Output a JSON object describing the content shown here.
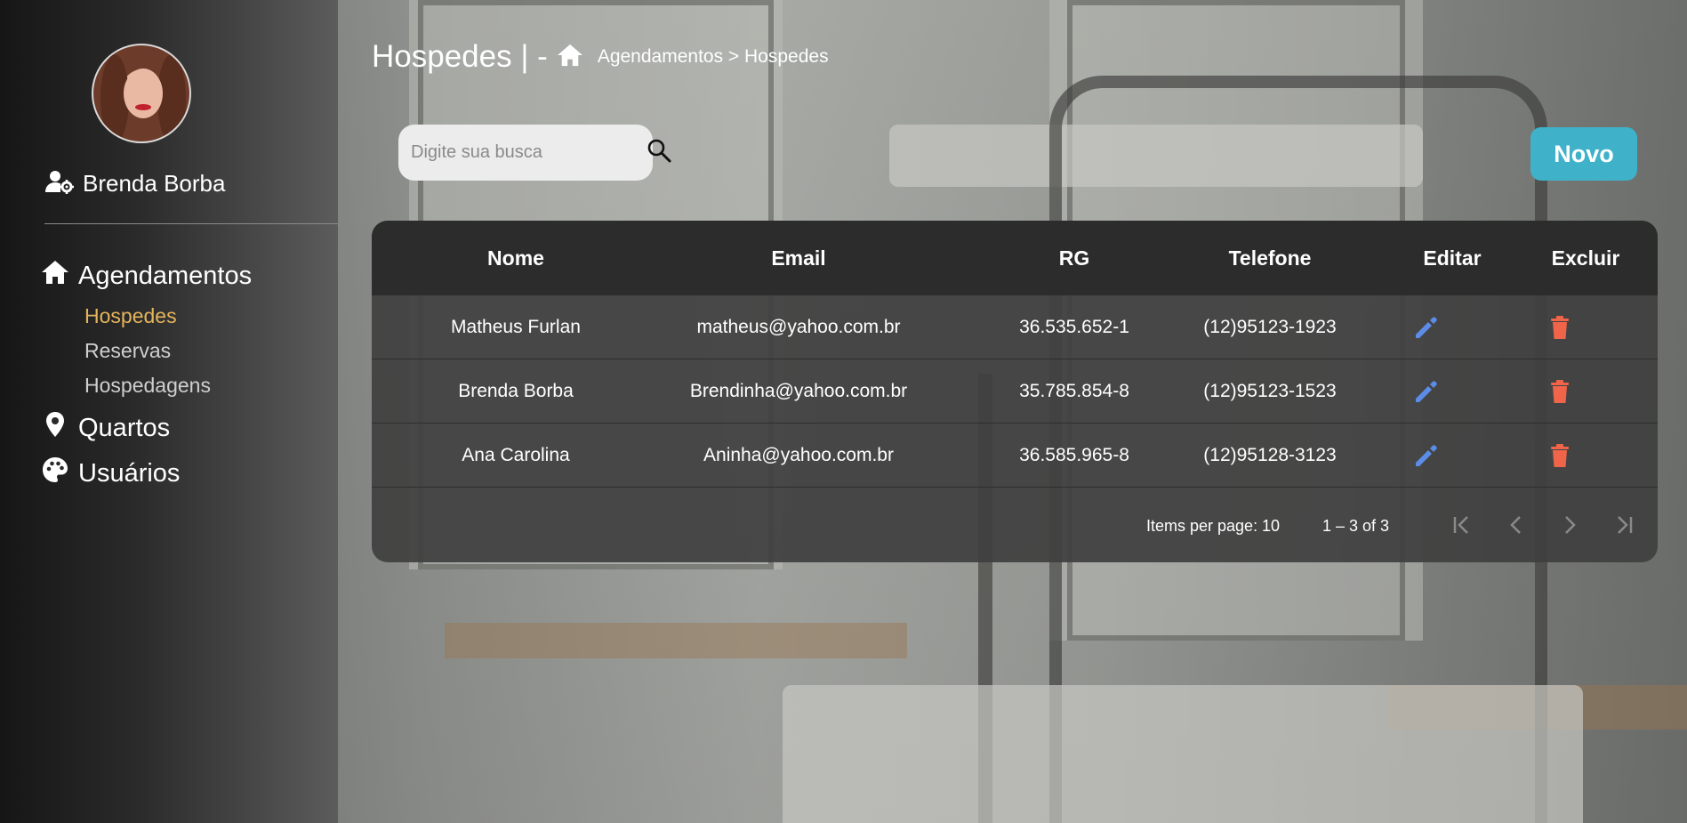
{
  "user": {
    "name": "Brenda Borba"
  },
  "nav": {
    "agendamentos": "Agendamentos",
    "sub_items": [
      {
        "label": "Hospedes",
        "active": true
      },
      {
        "label": "Reservas",
        "active": false
      },
      {
        "label": "Hospedagens",
        "active": false
      }
    ],
    "quartos": "Quartos",
    "usuarios": "Usuários"
  },
  "header": {
    "title": "Hospedes | -",
    "breadcrumb": "Agendamentos > Hospedes"
  },
  "search": {
    "placeholder": "Digite sua busca"
  },
  "toolbar": {
    "new_label": "Novo",
    "accent": "#3fb2c9"
  },
  "table": {
    "headers": {
      "nome": "Nome",
      "email": "Email",
      "rg": "RG",
      "telefone": "Telefone",
      "editar": "Editar",
      "excluir": "Excluir"
    },
    "rows": [
      {
        "nome": "Matheus Furlan",
        "email": "matheus@yahoo.com.br",
        "rg": "36.535.652-1",
        "telefone": "(12)95123-1923"
      },
      {
        "nome": "Brenda Borba",
        "email": "Brendinha@yahoo.com.br",
        "rg": "35.785.854-8",
        "telefone": "(12)95123-1523"
      },
      {
        "nome": "Ana Carolina",
        "email": "Aninha@yahoo.com.br",
        "rg": "36.585.965-8",
        "telefone": "(12)95128-3123"
      }
    ],
    "edit_icon_color": "#5b8de8",
    "delete_icon_color": "#f06449"
  },
  "paginator": {
    "items_per_page_label": "Items per page:",
    "items_per_page": "10",
    "range": "1 – 3 of 3"
  }
}
